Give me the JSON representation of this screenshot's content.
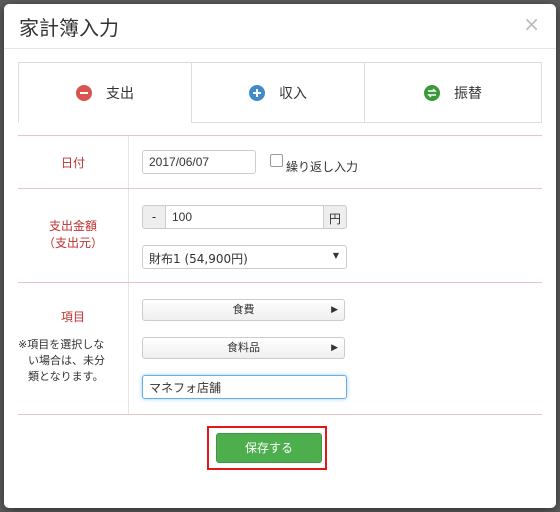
{
  "dialog": {
    "title": "家計簿入力",
    "close_glyph": "×"
  },
  "tabs": [
    {
      "label": "支出",
      "icon": "minus-circle-icon",
      "color": "#d9534f",
      "active": true
    },
    {
      "label": "収入",
      "icon": "plus-circle-icon",
      "color": "#428bca",
      "active": false
    },
    {
      "label": "振替",
      "icon": "transfer-icon",
      "color": "#3a9a3a",
      "active": false
    }
  ],
  "date_row": {
    "label": "日付",
    "value": "2017/06/07",
    "repeat_label": "繰り返し入力"
  },
  "amount_row": {
    "label_line1": "支出金額",
    "label_line2": "（支出元）",
    "sign": "-",
    "amount": "100",
    "unit": "円",
    "source_selected": "財布1 (54,900円)",
    "select_arrow": "▼"
  },
  "category_row": {
    "label": "項目",
    "note_line1": "※項目を選択しな",
    "note_line2": "い場合は、未分",
    "note_line3": "類となります。",
    "category": "食費",
    "subcategory": "食料品",
    "memo": "マネフォ店舗",
    "arrow": "▶"
  },
  "footer": {
    "save_label": "保存する"
  },
  "colors": {
    "accent_red": "#c03030",
    "save_green": "#4cae4c",
    "highlight": "#e0181b"
  }
}
